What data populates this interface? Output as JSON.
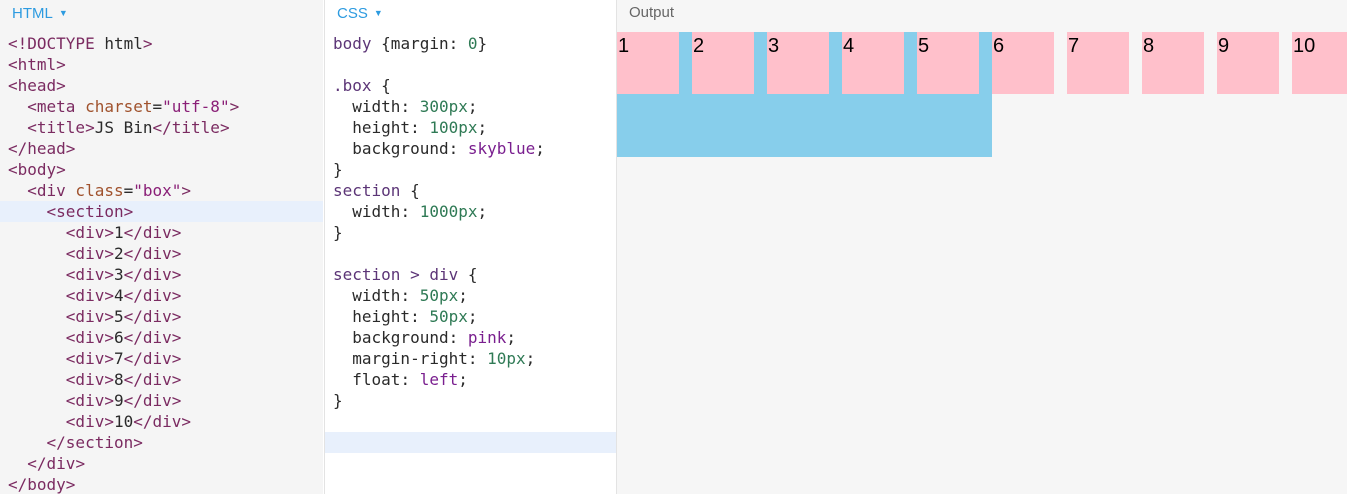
{
  "html_panel": {
    "title": "HTML",
    "lines": [
      "<!DOCTYPE html>",
      "<html>",
      "<head>",
      "  <meta charset=\"utf-8\">",
      "  <title>JS Bin</title>",
      "</head>",
      "<body>",
      "  <div class=\"box\">",
      "    <section>",
      "      <div>1</div>",
      "      <div>2</div>",
      "      <div>3</div>",
      "      <div>4</div>",
      "      <div>5</div>",
      "      <div>6</div>",
      "      <div>7</div>",
      "      <div>8</div>",
      "      <div>9</div>",
      "      <div>10</div>",
      "    </section>",
      "  </div>",
      "</body>"
    ],
    "highlighted_line": 8
  },
  "css_panel": {
    "title": "CSS",
    "lines": [
      "body {margin: 0}",
      "",
      ".box {",
      "  width: 300px;",
      "  height: 100px;",
      "  background: skyblue;",
      "}",
      "section {",
      "  width: 1000px;",
      "}",
      "",
      "section > div {",
      "  width: 50px;",
      "  height: 50px;",
      "  background: pink;",
      "  margin-right: 10px;",
      "  float: left;",
      "}",
      "",
      ""
    ],
    "highlighted_line": 19
  },
  "output_panel": {
    "title": "Output",
    "box_color": "#87ceeb",
    "item_color": "#ffc0cb",
    "items": [
      "1",
      "2",
      "3",
      "4",
      "5",
      "6",
      "7",
      "8",
      "9",
      "10"
    ]
  },
  "colors": {
    "header_blue": "#2d9be0",
    "tag": "#7b2b61",
    "number": "#2f7a55"
  }
}
